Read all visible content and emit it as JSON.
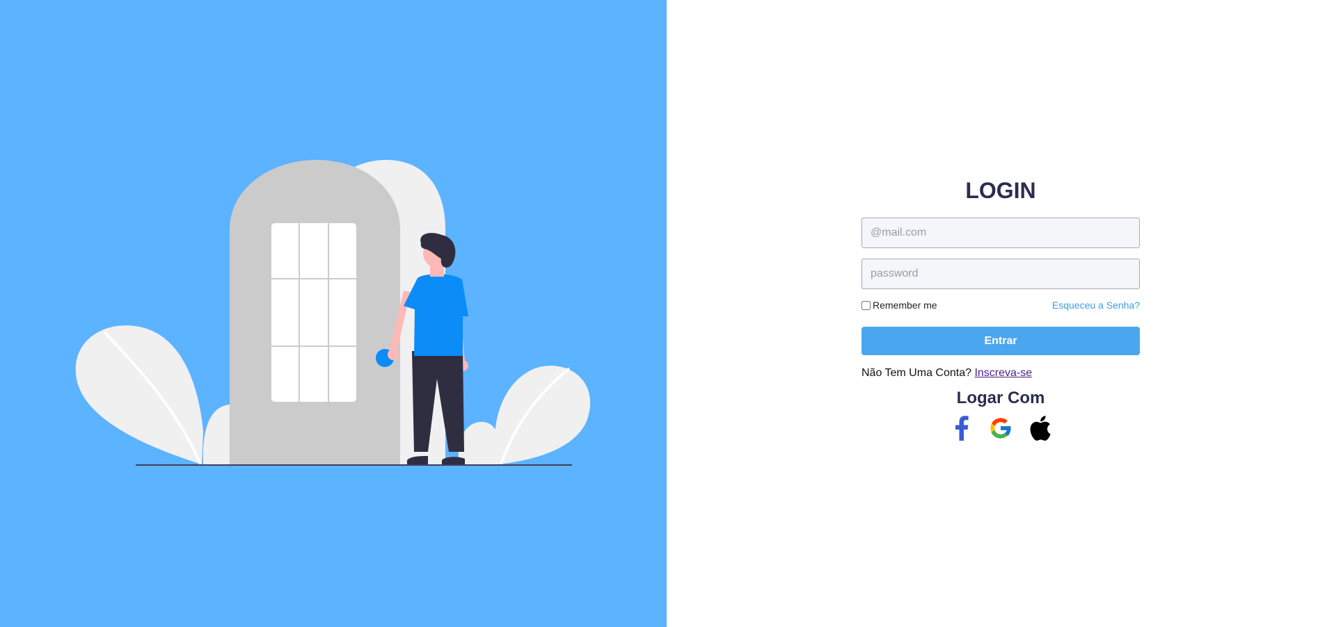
{
  "colors": {
    "hero_background": "#5cb3ff",
    "title": "#2b2d4f",
    "primary_button": "#4aa6ee",
    "link": "#3d9be9",
    "signup_link": "#4b1f8a"
  },
  "login": {
    "title": "LOGIN",
    "email_placeholder": "@mail.com",
    "email_value": "",
    "password_placeholder": "password",
    "password_value": "",
    "remember_label": "Remember me",
    "remember_checked": false,
    "forgot_label": "Esqueceu a Senha?",
    "submit_label": "Entrar",
    "signup_prompt": "Não Tem Uma Conta?",
    "signup_link": "Inscreva-se"
  },
  "social": {
    "title": "Logar Com",
    "providers": [
      {
        "name": "Facebook",
        "icon": "facebook-icon"
      },
      {
        "name": "Google",
        "icon": "google-icon"
      },
      {
        "name": "Apple",
        "icon": "apple-icon"
      }
    ]
  },
  "hero": {
    "illustration": "person-at-door-illustration"
  }
}
